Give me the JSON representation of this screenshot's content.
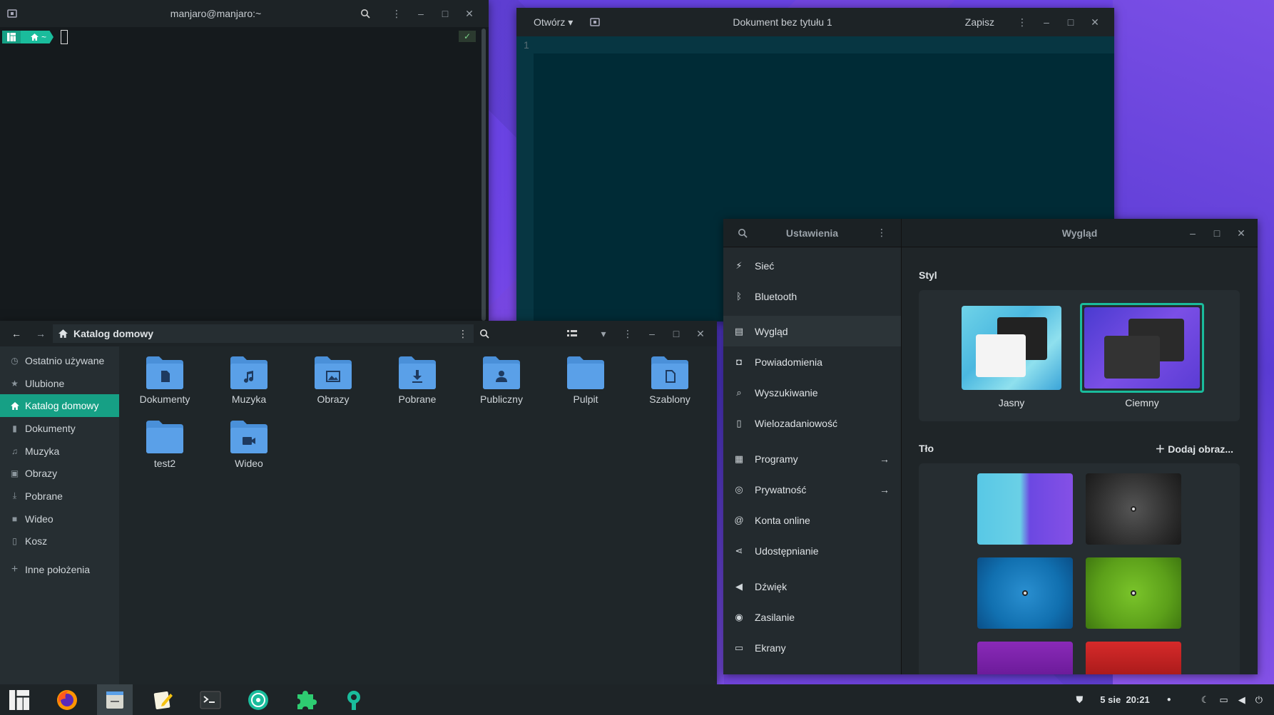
{
  "terminal": {
    "title": "manjaro@manjaro:~",
    "prompt_home": "~",
    "status_check": "✓"
  },
  "gedit": {
    "open_label": "Otwórz",
    "title": "Dokument bez tytułu 1",
    "save_label": "Zapisz",
    "line_number": "1"
  },
  "files": {
    "location": "Katalog domowy",
    "sidebar": [
      {
        "label": "Ostatnio używane",
        "icon": "clock-icon"
      },
      {
        "label": "Ulubione",
        "icon": "star-icon"
      },
      {
        "label": "Katalog domowy",
        "icon": "home-icon",
        "active": true
      },
      {
        "label": "Dokumenty",
        "icon": "document-icon"
      },
      {
        "label": "Muzyka",
        "icon": "music-icon"
      },
      {
        "label": "Obrazy",
        "icon": "image-icon"
      },
      {
        "label": "Pobrane",
        "icon": "download-icon"
      },
      {
        "label": "Wideo",
        "icon": "video-icon"
      },
      {
        "label": "Kosz",
        "icon": "trash-icon"
      }
    ],
    "other_locations": "Inne położenia",
    "folders": [
      {
        "label": "Dokumenty",
        "icon": "document"
      },
      {
        "label": "Muzyka",
        "icon": "music"
      },
      {
        "label": "Obrazy",
        "icon": "image"
      },
      {
        "label": "Pobrane",
        "icon": "download"
      },
      {
        "label": "Publiczny",
        "icon": "person"
      },
      {
        "label": "Pulpit",
        "icon": "desktop"
      },
      {
        "label": "Szablony",
        "icon": "template"
      },
      {
        "label": "test2",
        "icon": "none"
      },
      {
        "label": "Wideo",
        "icon": "video"
      }
    ]
  },
  "settings": {
    "left_title": "Ustawienia",
    "right_title": "Wygląd",
    "nav": [
      {
        "label": "Sieć",
        "icon": "network-icon"
      },
      {
        "label": "Bluetooth",
        "icon": "bluetooth-icon"
      },
      {
        "label": "Wygląd",
        "icon": "appearance-icon",
        "active": true
      },
      {
        "label": "Powiadomienia",
        "icon": "notification-icon"
      },
      {
        "label": "Wyszukiwanie",
        "icon": "search-icon"
      },
      {
        "label": "Wielozadaniowość",
        "icon": "multitasking-icon"
      },
      {
        "label": "Programy",
        "icon": "apps-icon",
        "arrow": true
      },
      {
        "label": "Prywatność",
        "icon": "privacy-icon",
        "arrow": true
      },
      {
        "label": "Konta online",
        "icon": "at-icon"
      },
      {
        "label": "Udostępnianie",
        "icon": "share-icon"
      },
      {
        "label": "Dźwięk",
        "icon": "sound-icon"
      },
      {
        "label": "Zasilanie",
        "icon": "power-icon"
      },
      {
        "label": "Ekrany",
        "icon": "display-icon"
      }
    ],
    "style_title": "Styl",
    "style_light": "Jasny",
    "style_dark": "Ciemny",
    "background_title": "Tło",
    "add_image": "Dodaj obraz..."
  },
  "taskbar": {
    "date": "5 sie",
    "time": "20:21"
  },
  "colors": {
    "accent": "#16a085",
    "accent_light": "#1abc9c",
    "folder_blue": "#4a90d9"
  }
}
